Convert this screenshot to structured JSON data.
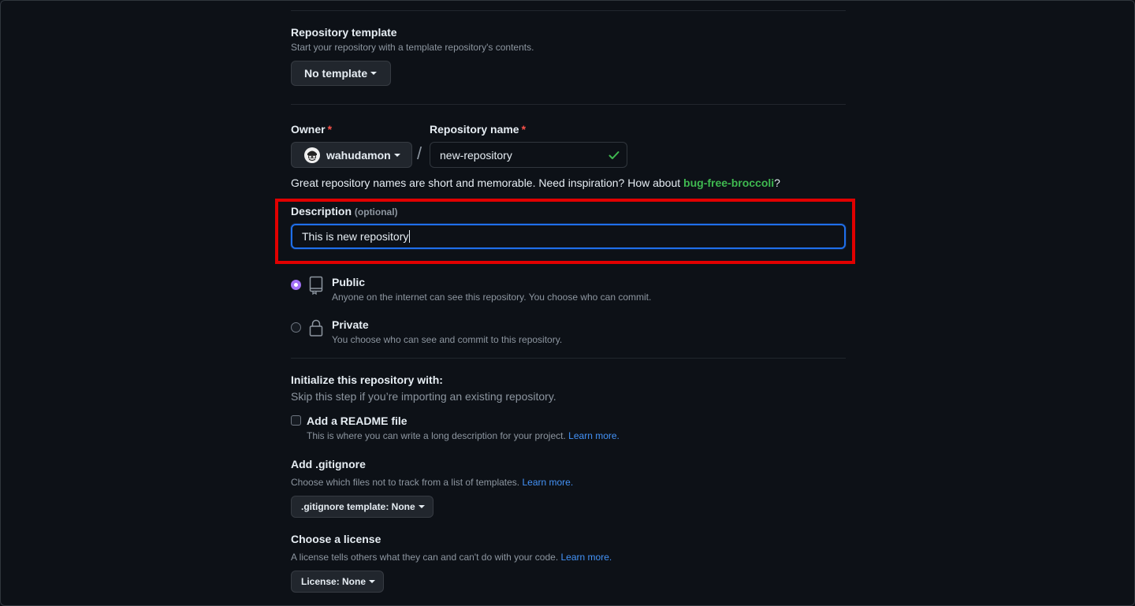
{
  "template": {
    "title": "Repository template",
    "subtitle": "Start your repository with a template repository's contents.",
    "button_label": "No template"
  },
  "owner": {
    "label": "Owner",
    "required_mark": "*",
    "value": "wahudamon"
  },
  "separator": "/",
  "repo_name": {
    "label": "Repository name",
    "required_mark": "*",
    "value": "new-repository",
    "hint_prefix": "Great repository names are short and memorable. Need inspiration? How about",
    "suggestion": "bug-free-broccoli",
    "hint_suffix": "?"
  },
  "description": {
    "label": "Description",
    "optional": "(optional)",
    "value": "This is new repository"
  },
  "visibility": {
    "public": {
      "label": "Public",
      "desc": "Anyone on the internet can see this repository. You choose who can commit.",
      "checked": true
    },
    "private": {
      "label": "Private",
      "desc": "You choose who can see and commit to this repository.",
      "checked": false
    }
  },
  "initialize": {
    "title": "Initialize this repository with:",
    "subtitle": "Skip this step if you’re importing an existing repository."
  },
  "readme": {
    "label": "Add a README file",
    "desc": "This is where you can write a long description for your project.",
    "link": "Learn more.",
    "checked": false
  },
  "gitignore": {
    "title": "Add .gitignore",
    "desc": "Choose which files not to track from a list of templates.",
    "link": "Learn more.",
    "button_label": ".gitignore template: None"
  },
  "license": {
    "title": "Choose a license",
    "desc": "A license tells others what they can and can't do with your code.",
    "link": "Learn more.",
    "button_label": "License: None"
  },
  "colors": {
    "background": "#0d1117",
    "link": "#4493f8",
    "success": "#3fb950",
    "required": "#f85149",
    "focus_border": "#1f6feb",
    "annotation_highlight": "#e10000",
    "radio_checked": "#a371f7"
  },
  "icons": {
    "check": "check-icon",
    "repo": "repo-icon",
    "lock": "lock-icon",
    "avatar": "avatar-icon"
  }
}
